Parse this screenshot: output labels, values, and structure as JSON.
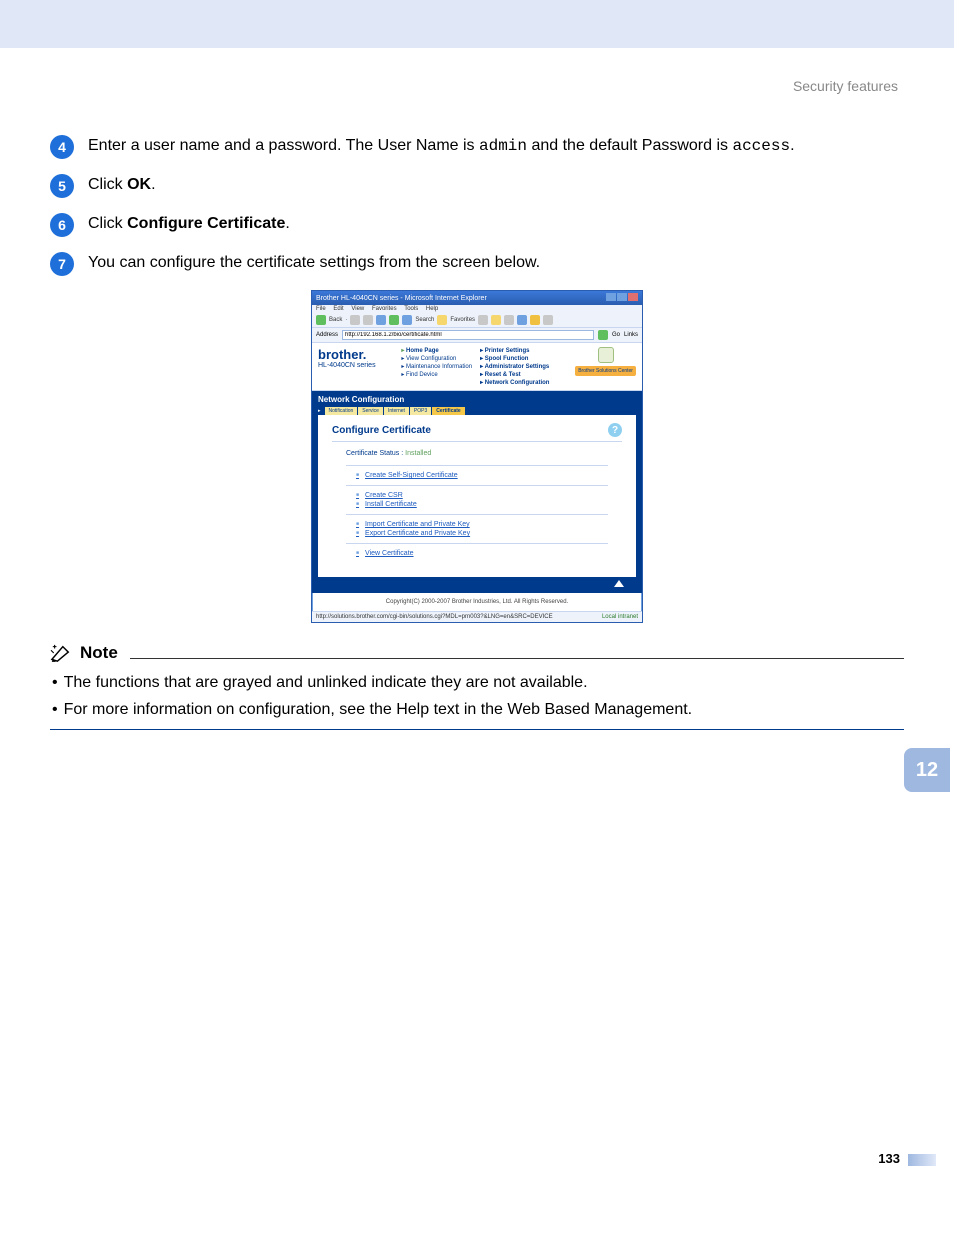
{
  "section_header": "Security features",
  "steps": [
    {
      "num": "4",
      "pre": "Enter a user name and a password. The User Name is ",
      "code1": "admin",
      "mid": " and the default Password is ",
      "code2": "access",
      "post": "."
    },
    {
      "num": "5",
      "pre": "Click ",
      "bold": "OK",
      "post": "."
    },
    {
      "num": "6",
      "pre": "Click ",
      "bold": "Configure Certificate",
      "post": "."
    },
    {
      "num": "7",
      "pre": "You can configure the certificate settings from the screen below."
    }
  ],
  "ie": {
    "title": "Brother HL-4040CN series - Microsoft Internet Explorer",
    "menus": [
      "File",
      "Edit",
      "View",
      "Favorites",
      "Tools",
      "Help"
    ],
    "toolbar": {
      "back": "Back",
      "search": "Search",
      "favorites": "Favorites"
    },
    "address_label": "Address",
    "address_url": "http://192.168.1.2/bio/certificate.html",
    "go": "Go",
    "links": "Links",
    "status_left": "http://solutions.brother.com/cgi-bin/solutions.cgi?MDL=prn003?&LNG=en&SRC=DEVICE",
    "status_right": "Local intranet"
  },
  "brother": {
    "logo": "brother.",
    "model": "HL-4040CN series",
    "links": [
      "Home Page",
      "Printer Settings",
      "View Configuration",
      "Spool Function",
      "Maintenance Information",
      "Administrator Settings",
      "Find Device",
      "Reset & Test",
      "",
      "Network Configuration"
    ],
    "solutions_btn": "Brother Solutions Center"
  },
  "netconf": {
    "title": "Network Configuration",
    "tabs": [
      "Notification",
      "Service",
      "Internet",
      "POP3",
      "Certificate"
    ],
    "active_tab": 4
  },
  "config": {
    "title": "Configure Certificate",
    "status_label": "Certificate Status :",
    "status_value": "Installed",
    "groups": [
      [
        "Create Self-Signed Certificate"
      ],
      [
        "Create CSR",
        "Install Certificate"
      ],
      [
        "Import Certificate and Private Key",
        "Export Certificate and Private Key"
      ],
      [
        "View Certificate"
      ]
    ]
  },
  "copyright": "Copyright(C) 2000-2007 Brother Industries, Ltd. All Rights Reserved.",
  "note": {
    "title": "Note",
    "items": [
      "The functions that are grayed and unlinked indicate they are not available.",
      "For more information on configuration, see the Help text in the Web Based Management."
    ]
  },
  "chapter": "12",
  "page_number": "133"
}
